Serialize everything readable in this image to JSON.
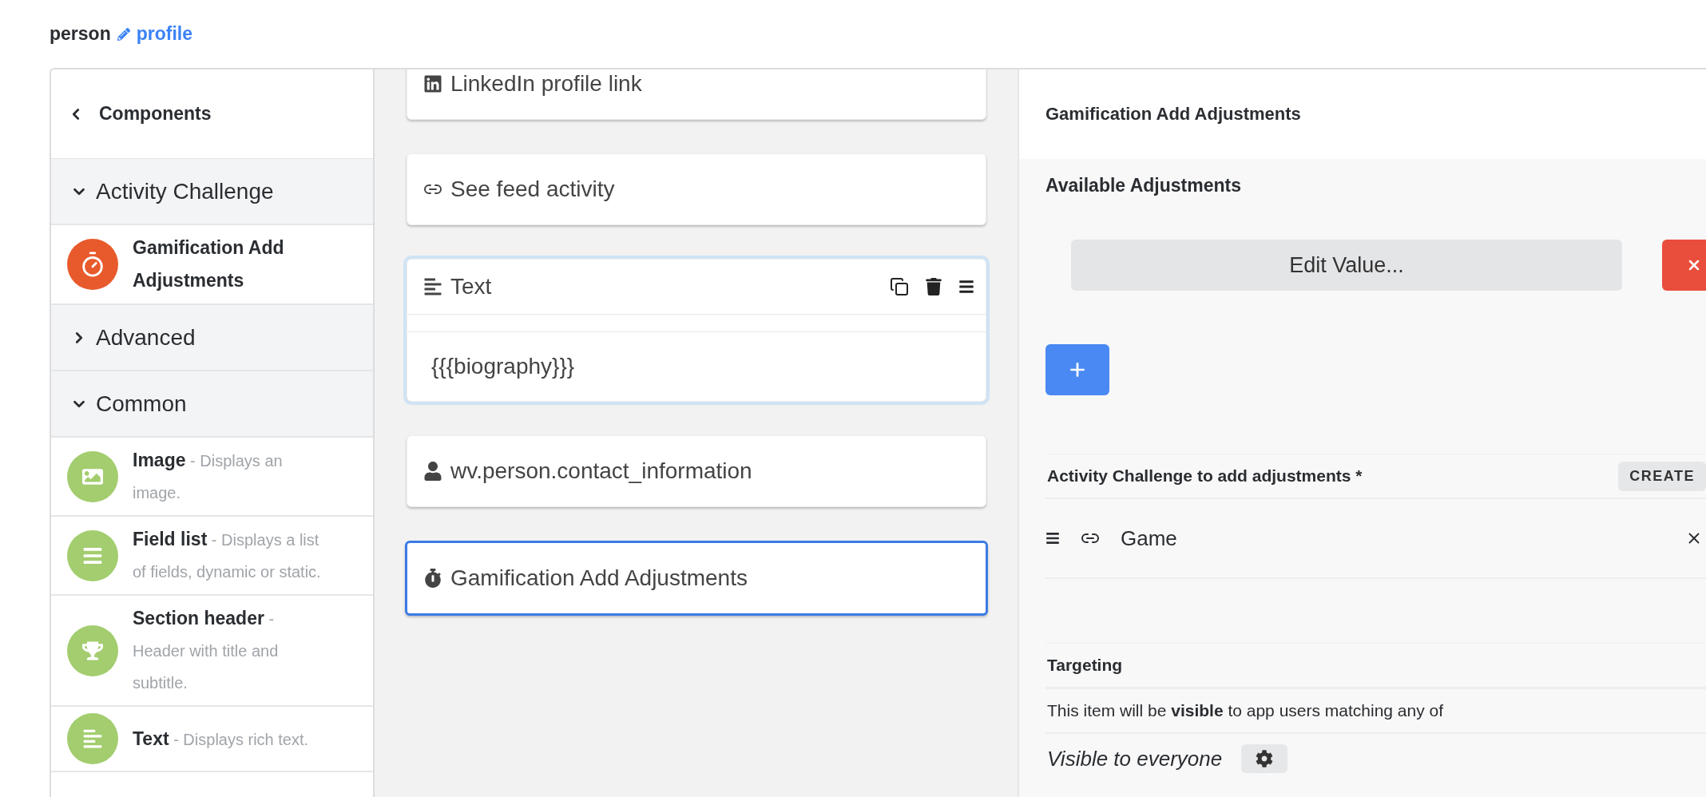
{
  "breadcrumb": {
    "entity": "person",
    "page": "profile"
  },
  "components_panel": {
    "title": "Components",
    "groups": [
      {
        "label": "Activity Challenge",
        "expanded": true,
        "items": [
          {
            "name": "Gamification Add Adjustments",
            "kind": "timer",
            "color": "#e85a2c"
          }
        ]
      },
      {
        "label": "Advanced",
        "expanded": false
      },
      {
        "label": "Common",
        "expanded": true,
        "items": [
          {
            "name": "Image",
            "description": "- Displays an image.",
            "kind": "image",
            "color": "#a3cd6e"
          },
          {
            "name": "Field list",
            "description": "- Displays a list of fields, dynamic or static.",
            "kind": "list",
            "color": "#a3cd6e"
          },
          {
            "name": "Section header",
            "description": "- Header with title and subtitle.",
            "kind": "trophy",
            "color": "#a3cd6e"
          },
          {
            "name": "Text",
            "description": "- Displays rich text.",
            "kind": "text",
            "color": "#a3cd6e"
          }
        ]
      }
    ]
  },
  "canvas_cards": [
    {
      "kind": "linkedin",
      "label": "LinkedIn profile link",
      "selected": false,
      "hovered": false
    },
    {
      "kind": "link",
      "label": "See feed activity",
      "selected": false,
      "hovered": false
    },
    {
      "kind": "text",
      "label": "Text",
      "body": "{{{biography}}}",
      "selected": false,
      "hovered": true
    },
    {
      "kind": "person",
      "label": "wv.person.contact_information",
      "selected": false,
      "hovered": false
    },
    {
      "kind": "timer",
      "label": "Gamification Add Adjustments",
      "selected": true,
      "hovered": false
    }
  ],
  "settings_panel": {
    "title": "Gamification Add Adjustments",
    "adjustments": {
      "title": "Available Adjustments",
      "items": [
        {
          "button": "Edit Value..."
        }
      ]
    },
    "relation": {
      "label": "Activity Challenge to add adjustments *",
      "create": "CREATE",
      "values": [
        {
          "label": "Game"
        }
      ]
    },
    "targeting": {
      "title": "Targeting",
      "sentence": "This item will be **visible** to app users matching any of",
      "audience": "Visible to everyone"
    }
  }
}
